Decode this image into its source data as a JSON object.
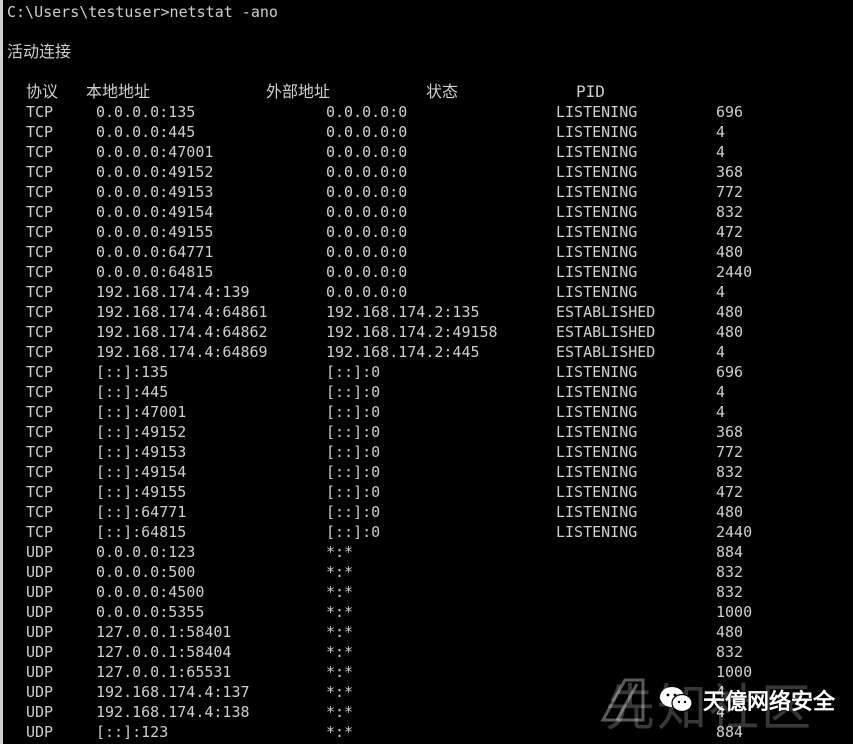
{
  "console": {
    "prompt": "C:\\Users\\testuser>netstat -ano",
    "heading": "活动连接",
    "columns": {
      "proto": "协议",
      "local": "本地地址",
      "foreign": "外部地址",
      "state": "状态",
      "pid": "PID"
    },
    "rows": [
      {
        "proto": "TCP",
        "local": "0.0.0.0:135",
        "foreign": "0.0.0.0:0",
        "state": "LISTENING",
        "pid": "696"
      },
      {
        "proto": "TCP",
        "local": "0.0.0.0:445",
        "foreign": "0.0.0.0:0",
        "state": "LISTENING",
        "pid": "4"
      },
      {
        "proto": "TCP",
        "local": "0.0.0.0:47001",
        "foreign": "0.0.0.0:0",
        "state": "LISTENING",
        "pid": "4"
      },
      {
        "proto": "TCP",
        "local": "0.0.0.0:49152",
        "foreign": "0.0.0.0:0",
        "state": "LISTENING",
        "pid": "368"
      },
      {
        "proto": "TCP",
        "local": "0.0.0.0:49153",
        "foreign": "0.0.0.0:0",
        "state": "LISTENING",
        "pid": "772"
      },
      {
        "proto": "TCP",
        "local": "0.0.0.0:49154",
        "foreign": "0.0.0.0:0",
        "state": "LISTENING",
        "pid": "832"
      },
      {
        "proto": "TCP",
        "local": "0.0.0.0:49155",
        "foreign": "0.0.0.0:0",
        "state": "LISTENING",
        "pid": "472"
      },
      {
        "proto": "TCP",
        "local": "0.0.0.0:64771",
        "foreign": "0.0.0.0:0",
        "state": "LISTENING",
        "pid": "480"
      },
      {
        "proto": "TCP",
        "local": "0.0.0.0:64815",
        "foreign": "0.0.0.0:0",
        "state": "LISTENING",
        "pid": "2440"
      },
      {
        "proto": "TCP",
        "local": "192.168.174.4:139",
        "foreign": "0.0.0.0:0",
        "state": "LISTENING",
        "pid": "4"
      },
      {
        "proto": "TCP",
        "local": "192.168.174.4:64861",
        "foreign": "192.168.174.2:135",
        "state": "ESTABLISHED",
        "pid": "480"
      },
      {
        "proto": "TCP",
        "local": "192.168.174.4:64862",
        "foreign": "192.168.174.2:49158",
        "state": "ESTABLISHED",
        "pid": "480"
      },
      {
        "proto": "TCP",
        "local": "192.168.174.4:64869",
        "foreign": "192.168.174.2:445",
        "state": "ESTABLISHED",
        "pid": "4"
      },
      {
        "proto": "TCP",
        "local": "[::]:135",
        "foreign": "[::]:0",
        "state": "LISTENING",
        "pid": "696"
      },
      {
        "proto": "TCP",
        "local": "[::]:445",
        "foreign": "[::]:0",
        "state": "LISTENING",
        "pid": "4"
      },
      {
        "proto": "TCP",
        "local": "[::]:47001",
        "foreign": "[::]:0",
        "state": "LISTENING",
        "pid": "4"
      },
      {
        "proto": "TCP",
        "local": "[::]:49152",
        "foreign": "[::]:0",
        "state": "LISTENING",
        "pid": "368"
      },
      {
        "proto": "TCP",
        "local": "[::]:49153",
        "foreign": "[::]:0",
        "state": "LISTENING",
        "pid": "772"
      },
      {
        "proto": "TCP",
        "local": "[::]:49154",
        "foreign": "[::]:0",
        "state": "LISTENING",
        "pid": "832"
      },
      {
        "proto": "TCP",
        "local": "[::]:49155",
        "foreign": "[::]:0",
        "state": "LISTENING",
        "pid": "472"
      },
      {
        "proto": "TCP",
        "local": "[::]:64771",
        "foreign": "[::]:0",
        "state": "LISTENING",
        "pid": "480"
      },
      {
        "proto": "TCP",
        "local": "[::]:64815",
        "foreign": "[::]:0",
        "state": "LISTENING",
        "pid": "2440"
      },
      {
        "proto": "UDP",
        "local": "0.0.0.0:123",
        "foreign": "*:*",
        "state": "",
        "pid": "884"
      },
      {
        "proto": "UDP",
        "local": "0.0.0.0:500",
        "foreign": "*:*",
        "state": "",
        "pid": "832"
      },
      {
        "proto": "UDP",
        "local": "0.0.0.0:4500",
        "foreign": "*:*",
        "state": "",
        "pid": "832"
      },
      {
        "proto": "UDP",
        "local": "0.0.0.0:5355",
        "foreign": "*:*",
        "state": "",
        "pid": "1000"
      },
      {
        "proto": "UDP",
        "local": "127.0.0.1:58401",
        "foreign": "*:*",
        "state": "",
        "pid": "480"
      },
      {
        "proto": "UDP",
        "local": "127.0.0.1:58404",
        "foreign": "*:*",
        "state": "",
        "pid": "832"
      },
      {
        "proto": "UDP",
        "local": "127.0.0.1:65531",
        "foreign": "*:*",
        "state": "",
        "pid": "1000"
      },
      {
        "proto": "UDP",
        "local": "192.168.174.4:137",
        "foreign": "*:*",
        "state": "",
        "pid": "4"
      },
      {
        "proto": "UDP",
        "local": "192.168.174.4:138",
        "foreign": "*:*",
        "state": "",
        "pid": "4"
      },
      {
        "proto": "UDP",
        "local": "[::]:123",
        "foreign": "*:*",
        "state": "",
        "pid": "884"
      }
    ]
  },
  "watermark": {
    "ghost_text": "先知社区",
    "account_name": "天億网络安全",
    "logo_icon": "slash-logo-icon",
    "chat_icon": "wechat-icon"
  },
  "colors": {
    "background": "#000000",
    "text": "#cfcfcf"
  }
}
